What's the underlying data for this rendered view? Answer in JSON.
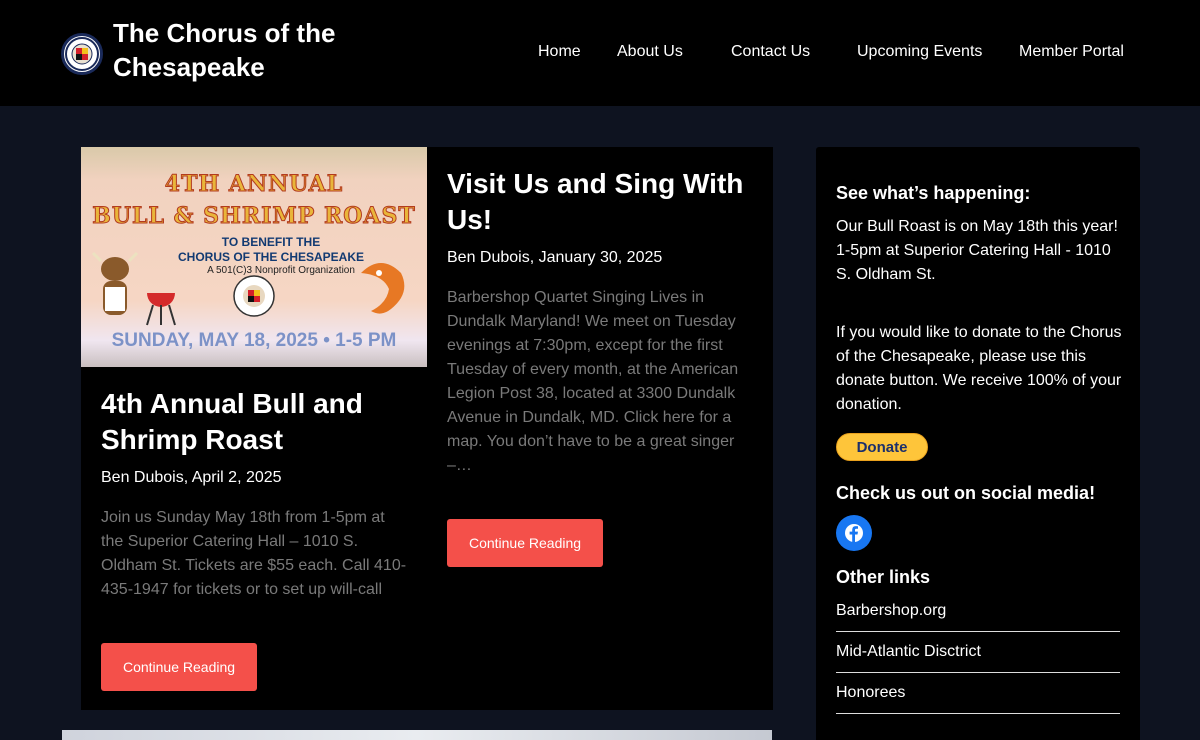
{
  "site": {
    "title": "The Chorus of the Chesapeake"
  },
  "nav": [
    "Home",
    "About Us",
    "Contact Us",
    "Upcoming Events",
    "Member Portal"
  ],
  "posts": [
    {
      "image_text": [
        "4TH ANNUAL",
        "BULL & SHRIMP ROAST",
        "TO BENEFIT THE",
        "CHORUS OF THE CHESAPEAKE",
        "A 501(C)3 Nonprofit Organization",
        "SUNDAY, MAY 18, 2025 • 1-5 PM"
      ],
      "title": "4th Annual Bull and Shrimp Roast",
      "meta": "Ben Dubois, April 2, 2025",
      "excerpt": "Join us Sunday May 18th from 1-5pm at the Superior Catering Hall – 1010 S. Oldham St. Tickets are $55 each. Call 410-435-1947 for tickets or to set up will-call",
      "button": "Continue Reading"
    },
    {
      "title": "Visit Us and Sing With Us!",
      "meta": "Ben Dubois, January 30, 2025",
      "excerpt": "Barbershop Quartet Singing Lives in Dundalk Maryland! We meet on Tuesday evenings at 7:30pm, except for the first Tuesday of every month, at the American Legion Post 38, located at 3300 Dundalk Avenue in Dundalk, MD.   Click here for a map. You don’t have to be a great singer –…",
      "button": "Continue Reading"
    }
  ],
  "sidebar": {
    "happening_heading": "See what’s happening:",
    "happening_text": "Our Bull Roast is on May 18th this year! 1-5pm at Superior Catering Hall - 1010 S. Oldham St.",
    "donate_text": "If you would like to donate to the Chorus of the Chesapeake, please use this donate button. We receive 100% of your donation.",
    "donate_button": "Donate",
    "social_heading": "Check us out on social media!",
    "social_icon": "facebook-icon",
    "links_heading": "Other links",
    "links": [
      "Barbershop.org",
      "Mid-Atlantic Disctrict",
      "Honorees"
    ]
  },
  "colors": {
    "accent": "#f4504a",
    "background": "#0e1320",
    "donate": "#fec53a",
    "facebook": "#1877f2"
  }
}
